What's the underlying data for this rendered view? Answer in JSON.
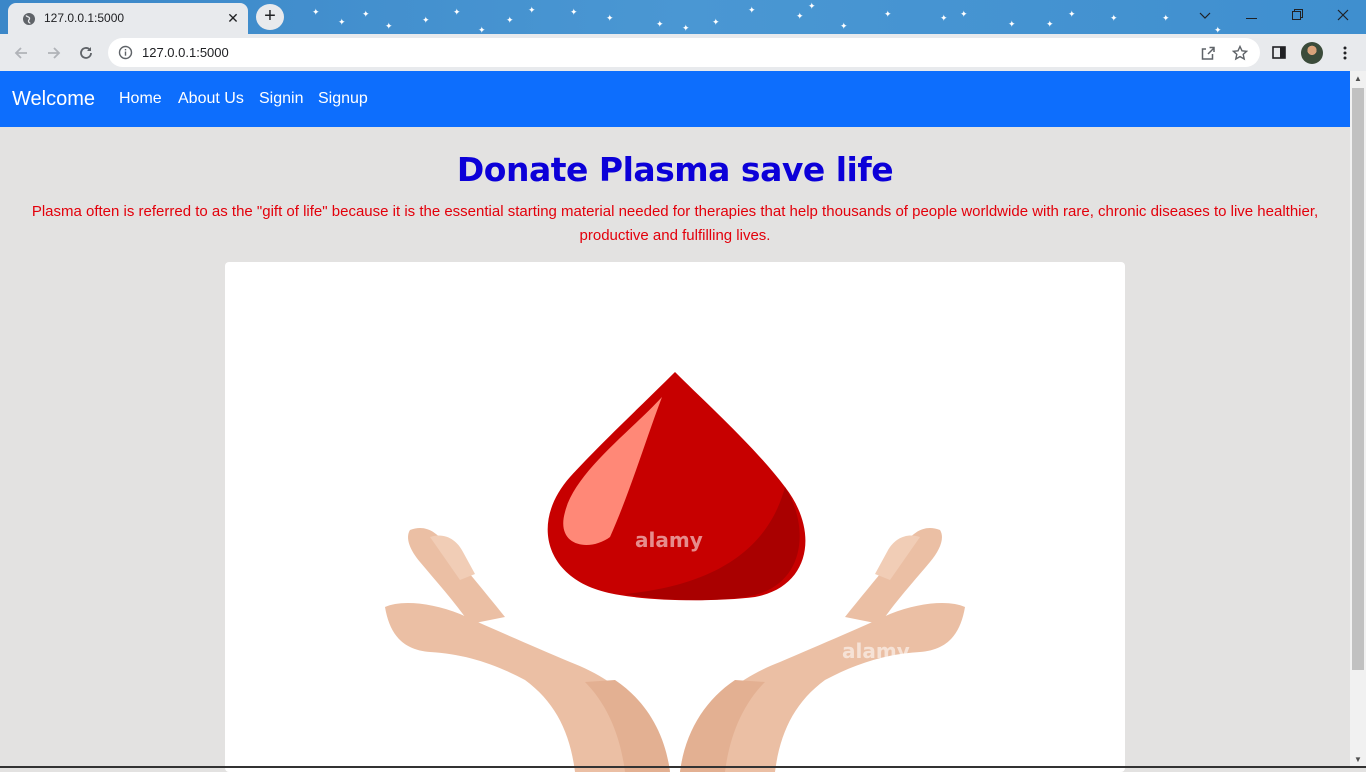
{
  "browser": {
    "tab_title": "127.0.0.1:5000",
    "tab_close_icon": "close-icon",
    "new_tab_icon": "plus-icon",
    "url": "127.0.0.1:5000",
    "window_controls": [
      "chevron-down-icon",
      "minimize-icon",
      "restore-icon",
      "close-icon"
    ],
    "toolbar_icons": [
      "back-icon",
      "forward-icon",
      "reload-icon",
      "info-icon",
      "share-icon",
      "star-icon",
      "side-panel-icon",
      "avatar",
      "menu-icon"
    ]
  },
  "navbar": {
    "brand": "Welcome",
    "links": [
      "Home",
      "About Us",
      "Signin",
      "Signup"
    ],
    "background": "#0d6efd"
  },
  "hero": {
    "title": "Donate Plasma save life",
    "description": "Plasma often is referred to as the \"gift of life\" because it is the essential starting material needed for therapies that help thousands of people worldwide with rare, chronic diseases to live healthier, productive and fulfilling lives.",
    "title_color": "#0c00d8",
    "description_color": "#e3000b"
  },
  "image": {
    "watermark": "alamy",
    "subject": "blood-drop-in-hands-image"
  }
}
